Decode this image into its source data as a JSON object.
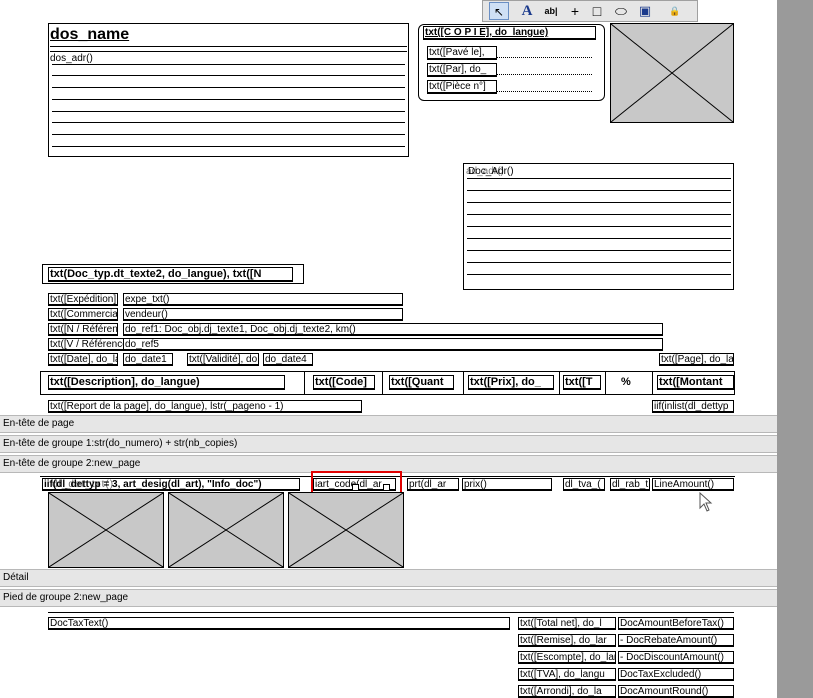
{
  "toolbar": {
    "items": [
      {
        "name": "pointer-tool-icon",
        "glyph": "↖"
      },
      {
        "name": "text-tool-icon",
        "glyph": "A"
      },
      {
        "name": "field-tool-icon",
        "glyph": "ab|"
      },
      {
        "name": "line-tool-icon",
        "glyph": "+"
      },
      {
        "name": "rectangle-tool-icon",
        "glyph": "□"
      },
      {
        "name": "ellipse-tool-icon",
        "glyph": "⬭"
      },
      {
        "name": "save-tool-icon",
        "glyph": "▣"
      },
      {
        "name": "lock-tool-icon",
        "glyph": "🔒"
      }
    ]
  },
  "header": {
    "dos_name": "dos_name",
    "dos_adr": "dos_adr()",
    "copie": "txt([C O P I E], do_langue)",
    "pave": "txt([Pavé le],",
    "par": "txt([Par], do_",
    "piece": "txt([Pièce n°]",
    "doc_adr": "Doc_Adr()",
    "doc_adr_overlap": "ad_adr()",
    "doc_typ": "txt(Doc_typ.dt_texte2, do_langue), txt([N",
    "expedition_label": "txt([Expédition],",
    "expedition_value": "expe_txt()",
    "commercial_label": "txt([Commercial]",
    "commercial_value": "vendeur()",
    "reference_label": "txt([N / Référen",
    "reference_value": "do_ref1: Doc_obj.dj_texte1, Doc_obj.dj_texte2, km()",
    "vref_label": "txt([V / Référence",
    "vref_value": "do_ref5",
    "date_label": "txt([Date], do_la",
    "date_value": "do_date1",
    "validite_label": "txt([Validité], do",
    "validite_value": "do_date4",
    "page_label": "txt([Page], do_la"
  },
  "columns": {
    "description": "txt([Description], do_langue)",
    "code": "txt([Code]",
    "quantite": "txt([Quant",
    "prix": "txt([Prix], do_",
    "tva": "txt([T",
    "percent": "%",
    "montant": "txt([Montant"
  },
  "report": {
    "report_page": "txt([Report de la page], do_langue), lstr(_pageno - 1)",
    "iif": "iif(inlist(dl_dettyp"
  },
  "bands": {
    "entete_page": "En-tête de page",
    "entete_groupe1": "En-tête de groupe 1:str(do_numero) + str(nb_copies)",
    "entete_groupe2": "En-tête de groupe 2:new_page",
    "detail": "Détail",
    "pied_groupe2": "Pied de groupe 2:new_page"
  },
  "detail": {
    "overlapped1": "iif(dl_dettyp = 3, art_desig(dl_art), \"Info_doc\")",
    "overlapped2": "dl_det_txt()",
    "art_code": "iart_code(dl_ar",
    "prt": "prt(dl_ar",
    "prix": "prix()",
    "tva": "dl_tva_(",
    "rab": "dl_rab_t",
    "line_amount": "LineAmount()"
  },
  "footer": {
    "doc_tax_text": "DocTaxText()",
    "total_net_label": "txt([Total net], do_l",
    "total_net_value": "DocAmountBeforeTax()",
    "remise_label": "txt([Remise], do_lar",
    "remise_value": "- DocRebateAmount()",
    "escompte_label": "txt([Escompte], do_lan",
    "escompte_value": "- DocDiscountAmount()",
    "tva_label": "txt([TVA], do_langu",
    "tva_value": "DocTaxExcluded()",
    "arrondi_label": "txt([Arrondi], do_la",
    "arrondi_value": "DocAmountRound()"
  }
}
